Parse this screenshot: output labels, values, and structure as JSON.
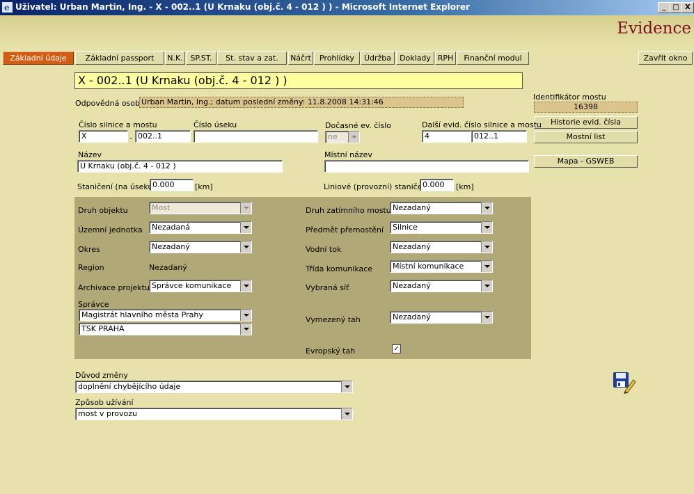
{
  "window": {
    "title": "Uživatel: Urban Martin, Ing. - X - 002..1 (U Krnaku (obj.č. 4 - 012 ) ) - Microsoft Internet Explorer",
    "min": "_",
    "max": "□",
    "close": "X"
  },
  "brand": "Evidence",
  "tabs": [
    "Základní údaje",
    "Základní passport",
    "N.K.",
    "SP.ST.",
    "St. stav a zat.",
    "Náčrt",
    "Prohlídky",
    "Údržba",
    "Doklady",
    "RPH",
    "Finanční modul"
  ],
  "close_window": "Zavřít okno",
  "record_title": "X - 002..1 (U Krnaku (obj.č. 4 - 012 ) )",
  "responsible": {
    "label": "Odpovědná osoba",
    "value": "Urban Martin, Ing.; datum poslední změny: 11.8.2008 14:31:46"
  },
  "bridge_id": {
    "label": "Identifikátor mostu",
    "value": "16398"
  },
  "side_buttons": {
    "history": "Historie evid. čísla",
    "bridge_sheet": "Mostní list",
    "map": "Mapa - GSWEB"
  },
  "road_number": {
    "label": "Číslo silnice a mostu",
    "part1": "X",
    "sep": "-",
    "part2": "002..1"
  },
  "section_number": {
    "label": "Číslo úseku",
    "value": ""
  },
  "temp_number": {
    "label": "Dočasné ev. číslo",
    "value": "ne"
  },
  "other_number": {
    "label": "Další evid. číslo silnice a mostu",
    "part1": "4",
    "part2": "012..1"
  },
  "name": {
    "label": "Název",
    "value": "U Krnaku (obj.č. 4 - 012 )"
  },
  "local_name": {
    "label": "Místní název",
    "value": ""
  },
  "chainage": {
    "label": "Staničení (na úseku)",
    "value": "0.000",
    "unit": "[km]"
  },
  "line_chainage": {
    "label": "Liniové (provozní) staničení",
    "value": "0.000",
    "unit": "[km]"
  },
  "panel": {
    "object_type": {
      "label": "Druh objektu",
      "value": "Most"
    },
    "territorial_unit": {
      "label": "Územní jednotka",
      "value": "Nezadaná"
    },
    "district": {
      "label": "Okres",
      "value": "Nezadaný"
    },
    "region": {
      "label": "Region",
      "value": "Nezadaný"
    },
    "archive_project": {
      "label": "Archivace projektu",
      "value": "Správce komunikace"
    },
    "manager": {
      "label": "Správce",
      "value1": "Magistrát hlavního města Prahy",
      "value2": "TSK PRAHA"
    },
    "load_type": {
      "label": "Druh zatímního mostu",
      "value": "Nezadaný"
    },
    "crossing": {
      "label": "Předmět přemostění",
      "value": "Silnice"
    },
    "water": {
      "label": "Vodní tok",
      "value": "Nezadaný"
    },
    "road_class": {
      "label": "Třída komunikace",
      "value": "Místní komunikace"
    },
    "network": {
      "label": "Vybraná síť",
      "value": "Nezadaný"
    },
    "route": {
      "label": "Vymezený tah",
      "value": "Nezadaný"
    },
    "euro_route": {
      "label": "Evropský tah",
      "checked": "✓"
    }
  },
  "change_reason": {
    "label": "Důvod změny",
    "value": "doplnění chybějícího údaje"
  },
  "usage": {
    "label": "Způsob užívání",
    "value": "most v provozu"
  }
}
